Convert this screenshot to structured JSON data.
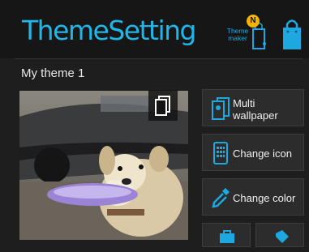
{
  "header": {
    "title": "ThemeSetting",
    "theme_maker": {
      "label_line1": "Theme",
      "label_line2": "maker",
      "badge": "N"
    }
  },
  "section": {
    "title": "My theme 1"
  },
  "actions": {
    "multi_wallpaper": {
      "line1": "Multi",
      "line2": "wallpaper"
    },
    "change_icon": "Change icon",
    "change_color": "Change color"
  },
  "colors": {
    "accent": "#20b6e8",
    "background": "#1e1e1e",
    "badge": "#f4b400",
    "button": "#2c2c2c"
  },
  "icons": [
    "theme-maker-icon",
    "shopping-bag-icon",
    "copy-icon",
    "multi-wallpaper-icon",
    "app-grid-icon",
    "eyedropper-icon"
  ]
}
